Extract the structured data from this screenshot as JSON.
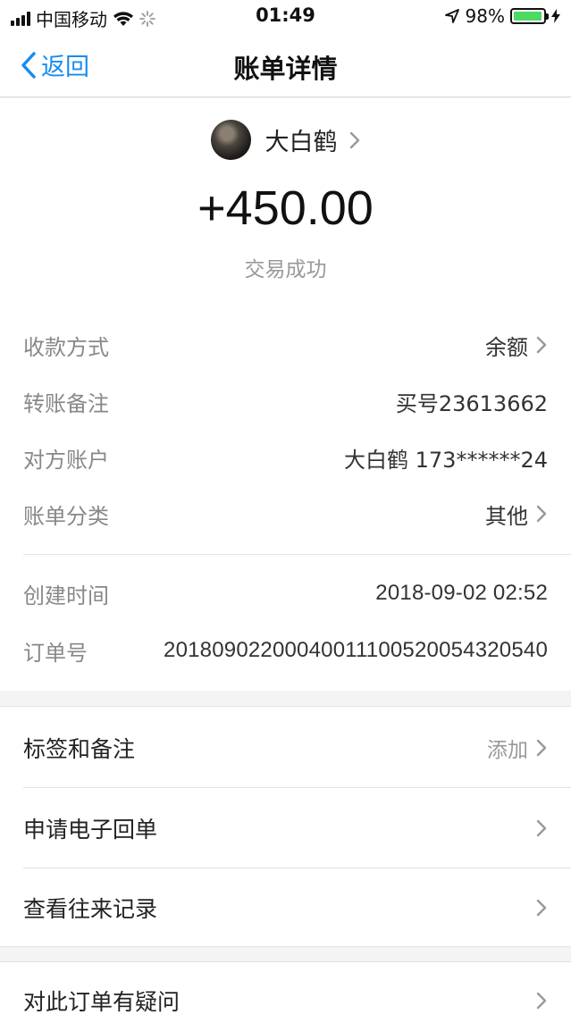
{
  "status_bar": {
    "carrier": "中国移动",
    "time": "01:49",
    "battery_percent": "98%",
    "battery_level": 0.98,
    "battery_color": "#4cd964"
  },
  "nav": {
    "back_label": "返回",
    "title": "账单详情",
    "accent_color": "#1a8cf0"
  },
  "payer": {
    "name": "大白鹤"
  },
  "amount": "+450.00",
  "status": "交易成功",
  "details": [
    {
      "label": "收款方式",
      "value": "余额",
      "chevron": true
    },
    {
      "label": "转账备注",
      "value": "买号23613662",
      "chevron": false
    },
    {
      "label": "对方账户",
      "value": "大白鹤 173******24",
      "chevron": false
    },
    {
      "label": "账单分类",
      "value": "其他",
      "chevron": true
    }
  ],
  "meta": [
    {
      "label": "创建时间",
      "value": "2018-09-02 02:52"
    },
    {
      "label": "订单号",
      "value": "20180902200040011100520054320540"
    }
  ],
  "actions": [
    {
      "label": "标签和备注",
      "value": "添加"
    },
    {
      "label": "申请电子回单",
      "value": ""
    },
    {
      "label": "查看往来记录",
      "value": ""
    }
  ],
  "actions2": [
    {
      "label": "对此订单有疑问",
      "value": ""
    }
  ],
  "icons": [
    "signal-icon",
    "wifi-icon",
    "loading-icon",
    "location-icon",
    "battery-icon",
    "charging-icon",
    "back-chevron-icon",
    "chevron-right-icon"
  ]
}
